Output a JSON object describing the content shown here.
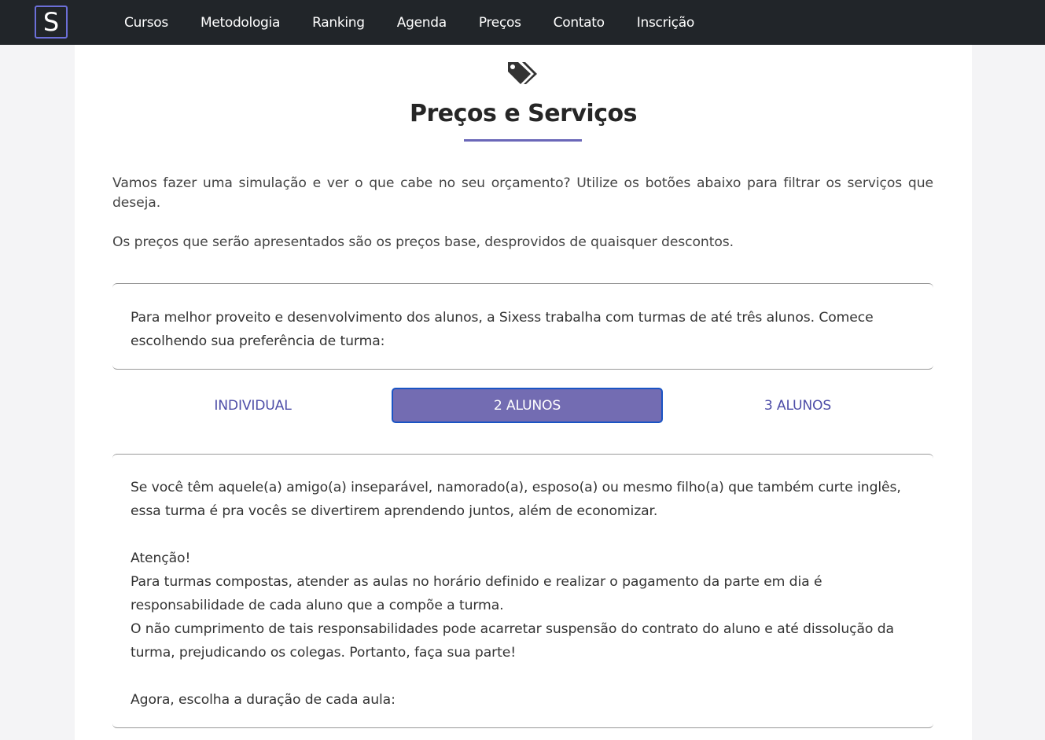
{
  "navbar": {
    "logo_letter": "S",
    "links": [
      "Cursos",
      "Metodologia",
      "Ranking",
      "Agenda",
      "Preços",
      "Contato",
      "Inscrição"
    ]
  },
  "header": {
    "icon": "tags-icon",
    "title": "Preços e Serviços"
  },
  "intro": {
    "paragraph1": "Vamos fazer uma simulação e ver o que cabe no seu orçamento? Utilize os botões abaixo para filtrar os serviços que deseja.",
    "paragraph2": "Os preços que serão apresentados são os preços base, desprovidos de quaisquer descontos."
  },
  "class_choice": {
    "text": "Para melhor proveito e desenvolvimento dos alunos, a Sixess trabalha com turmas de até três alunos. Comece escolhendo sua preferência de turma:",
    "options": [
      "INDIVIDUAL",
      "2 ALUNOS",
      "3 ALUNOS"
    ],
    "selected": "2 ALUNOS"
  },
  "details": {
    "line1": "Se você têm aquele(a) amigo(a) inseparável, namorado(a), esposo(a) ou mesmo filho(a) que também curte inglês, essa turma é pra vocês se divertirem aprendendo juntos, além de economizar.",
    "attention": "Atenção!",
    "line2": "Para turmas compostas, atender as aulas no horário definido e realizar o pagamento da parte em dia é responsabilidade de cada aluno que a compõe a turma.",
    "line3": "O não cumprimento de tais responsabilidades pode acarretar suspensão do contrato do aluno e até dissolução da turma, prejudicando os colegas. Portanto, faça sua parte!",
    "prompt": "Agora, escolha a duração de cada aula:"
  },
  "colors": {
    "navbar_bg": "#212529",
    "accent": "#736cb2",
    "accent_text": "#4e4ea8",
    "selected_border": "#1a54c4"
  }
}
